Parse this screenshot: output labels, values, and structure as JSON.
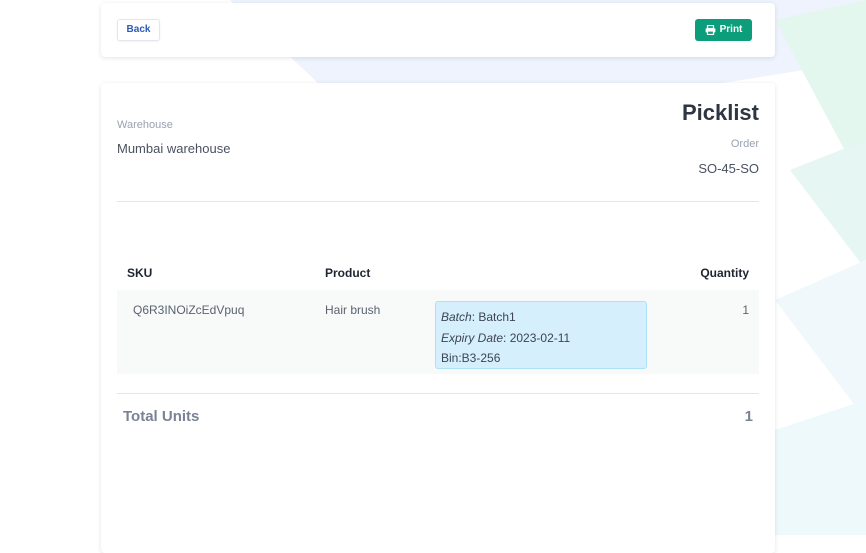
{
  "toolbar": {
    "back_label": "Back",
    "print_label": "Print",
    "print_icon": "printer-icon"
  },
  "header": {
    "warehouse_label": "Warehouse",
    "warehouse_value": "Mumbai warehouse",
    "title": "Picklist",
    "order_label": "Order",
    "order_value": "SO-45-SO"
  },
  "table": {
    "columns": [
      "SKU",
      "Product",
      "Quantity"
    ],
    "rows": [
      {
        "sku": "Q6R3INOiZcEdVpuq",
        "product": "Hair brush",
        "batch_label": "Batch",
        "batch_value": "Batch1",
        "expiry_label": "Expiry Date",
        "expiry_value": "2023-02-11",
        "bin_text": "Bin:B3-256",
        "quantity": "1"
      }
    ]
  },
  "totals": {
    "label": "Total Units",
    "value": "1"
  },
  "colors": {
    "print_button": "#0c9e7b",
    "back_text": "#2c5bb5",
    "batch_box_bg": "#d5effc",
    "batch_box_border": "#aee0f7"
  }
}
